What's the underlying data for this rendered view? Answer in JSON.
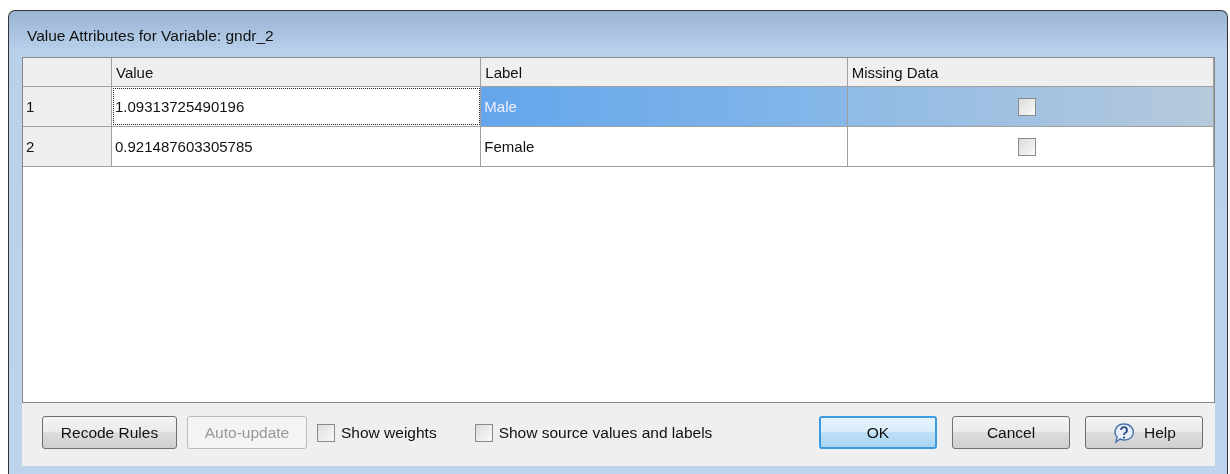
{
  "window": {
    "title": "Value Attributes for Variable: gndr_2"
  },
  "table": {
    "columns": [
      "Value",
      "Label",
      "Missing Data"
    ],
    "rows": [
      {
        "number": "1",
        "value": "1.09313725490196",
        "label": "Male",
        "missing": false,
        "selected": true
      },
      {
        "number": "2",
        "value": "0.921487603305785",
        "label": "Female",
        "missing": false,
        "selected": false
      }
    ]
  },
  "footer": {
    "left_buttons": [
      {
        "label": "Recode Rules",
        "disabled": false
      },
      {
        "label": "Auto-update",
        "disabled": true
      }
    ],
    "checkboxes": [
      {
        "label": "Show weights",
        "checked": false
      },
      {
        "label": "Show source values and labels",
        "checked": false
      }
    ],
    "right_buttons": [
      {
        "label": "OK",
        "kind": "default"
      },
      {
        "label": "Cancel",
        "kind": "plain"
      },
      {
        "label": "Help",
        "kind": "help"
      }
    ]
  }
}
